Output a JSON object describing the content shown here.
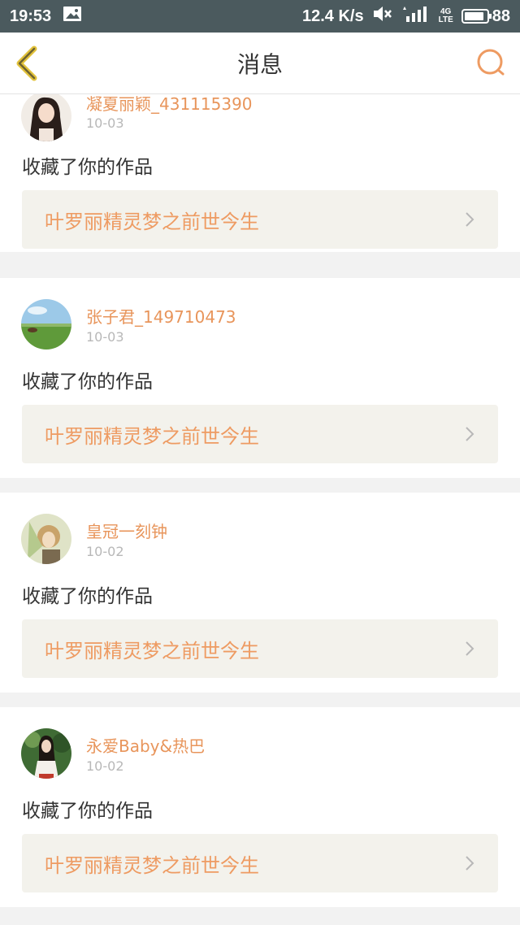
{
  "status_bar": {
    "time": "19:53",
    "net_speed": "12.4 K/s",
    "network_label": "4G",
    "network_sub": "LTE",
    "battery": "88"
  },
  "header": {
    "title": "消息",
    "back_icon": "chevron-left-icon",
    "search_icon": "search-icon"
  },
  "colors": {
    "accent": "#ee9b62",
    "name_color": "#e8955b",
    "back_arrow": "#e2c23b"
  },
  "messages": [
    {
      "user": "凝夏丽颖_431115390",
      "date": "10-03",
      "action": "收藏了你的作品",
      "work": "叶罗丽精灵梦之前世今生"
    },
    {
      "user": "张子君_149710473",
      "date": "10-03",
      "action": "收藏了你的作品",
      "work": "叶罗丽精灵梦之前世今生"
    },
    {
      "user": "皇冠一刻钟",
      "date": "10-02",
      "action": "收藏了你的作品",
      "work": "叶罗丽精灵梦之前世今生"
    },
    {
      "user": "永爱Baby&热巴",
      "date": "10-02",
      "action": "收藏了你的作品",
      "work": "叶罗丽精灵梦之前世今生"
    }
  ]
}
